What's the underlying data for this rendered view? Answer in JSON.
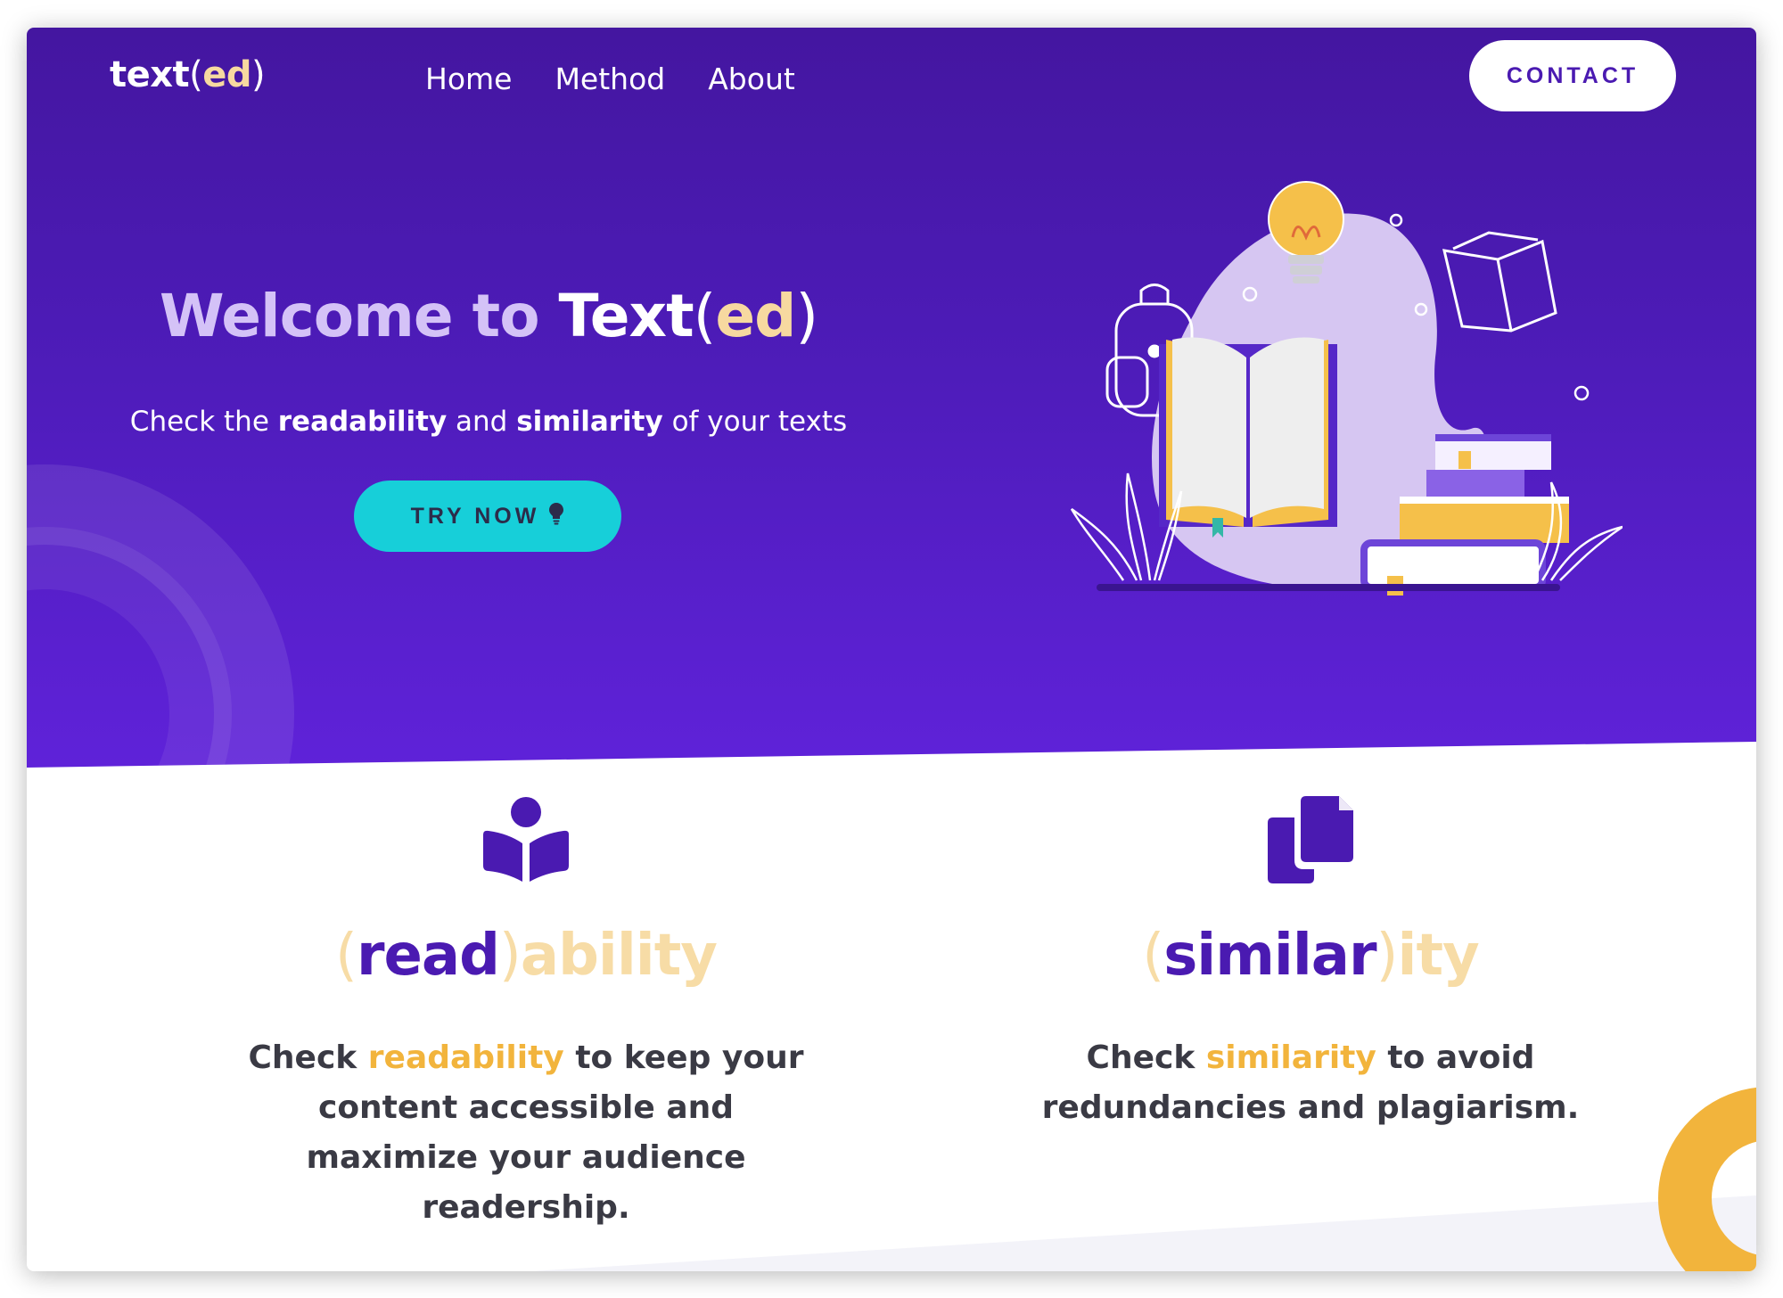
{
  "brand": {
    "main": "text",
    "open": "(",
    "accent": "ed",
    "close": ")"
  },
  "nav": [
    {
      "label": "Home"
    },
    {
      "label": "Method"
    },
    {
      "label": "About"
    }
  ],
  "contact_label": "CONTACT",
  "hero": {
    "title_part1": "Welcome to ",
    "title_part2": "Text",
    "title_open": "(",
    "title_accent": "ed",
    "title_close": ")",
    "subtitle_pre": "Check the ",
    "subtitle_b1": "readability",
    "subtitle_mid": " and ",
    "subtitle_b2": "similarity",
    "subtitle_post": " of your texts",
    "cta_label": "TRY NOW"
  },
  "features": [
    {
      "icon": "reader-icon",
      "open": "(",
      "main": "read",
      "close": ")",
      "suffix": "ability",
      "desc_pre": "Check ",
      "desc_highlight": "readability",
      "desc_post": " to keep your content accessible and maximize your audience readership."
    },
    {
      "icon": "copy-icon",
      "open": "(",
      "main": "similar",
      "close": ")",
      "suffix": "ity",
      "desc_pre": "Check ",
      "desc_highlight": "similarity",
      "desc_post": " to avoid redundancies and plagiarism."
    }
  ],
  "colors": {
    "hero_purple": "#4c1bb6",
    "accent_cyan": "#17cfd9",
    "accent_gold": "#f2b43c",
    "accent_cream": "#f7d9a0",
    "lavender": "#d4c2f7"
  }
}
